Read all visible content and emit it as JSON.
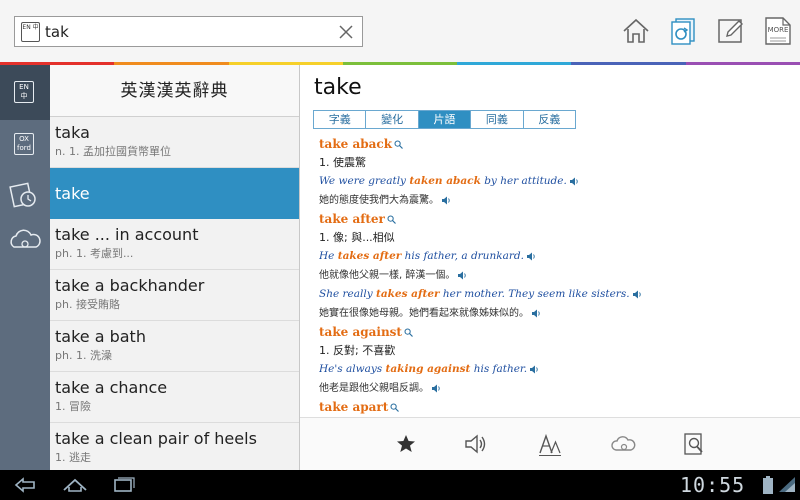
{
  "search": {
    "lang_badge": "EN 中",
    "value": "tak",
    "placeholder": ""
  },
  "toolbar": {
    "more_label": "MORE",
    "icons": [
      "home-icon",
      "flashcard-sync-icon",
      "note-edit-icon",
      "more-icon"
    ]
  },
  "rail": {
    "items": [
      {
        "icon": "en-zh-dictionary-icon",
        "badge": "EN 中"
      },
      {
        "icon": "oxford-dictionary-icon",
        "badge": "OX ford"
      },
      {
        "icon": "history-icon"
      },
      {
        "icon": "cloud-settings-icon"
      }
    ]
  },
  "wordlist": {
    "header": "英漢漢英辭典",
    "items": [
      {
        "word": "taka",
        "gloss": "n. 1. 孟加拉國貨幣單位"
      },
      {
        "word": "take",
        "gloss": "",
        "selected": true
      },
      {
        "word": "take ... in account",
        "gloss": "ph. 1. 考慮到..."
      },
      {
        "word": "take a backhander",
        "gloss": "ph. 接受賄賂"
      },
      {
        "word": "take a bath",
        "gloss": "ph. 1. 洗澡"
      },
      {
        "word": "take a chance",
        "gloss": "1. 冒險"
      },
      {
        "word": "take a clean pair of heels",
        "gloss": "1. 逃走"
      }
    ]
  },
  "definition": {
    "headword": "take",
    "tabs": [
      {
        "label": "字義",
        "active": false
      },
      {
        "label": "變化",
        "active": false
      },
      {
        "label": "片語",
        "active": true
      },
      {
        "label": "同義",
        "active": false
      },
      {
        "label": "反義",
        "active": false
      }
    ],
    "entries": [
      {
        "type": "phrase",
        "text": "take aback"
      },
      {
        "type": "meaning",
        "text": "1. 使震驚"
      },
      {
        "type": "ex_en",
        "before": "We were greatly ",
        "hl": "taken aback",
        "after": " by her attitude."
      },
      {
        "type": "ex_zh",
        "text": "她的態度使我們大為震驚。"
      },
      {
        "type": "phrase",
        "text": "take after"
      },
      {
        "type": "meaning",
        "text": "1. 像; 與...相似"
      },
      {
        "type": "ex_en",
        "before": "He ",
        "hl": "takes after",
        "after": " his father, a drunkard."
      },
      {
        "type": "ex_zh",
        "text": "他就像他父親一樣, 醉漢一個。"
      },
      {
        "type": "ex_en",
        "before": "She really ",
        "hl": "takes after",
        "after": " her mother. They seem like sisters."
      },
      {
        "type": "ex_zh",
        "text": "她實在很像她母親。她們看起來就像姊妹似的。"
      },
      {
        "type": "phrase",
        "text": "take against"
      },
      {
        "type": "meaning",
        "text": "1. 反對; 不喜歡"
      },
      {
        "type": "ex_en",
        "before": "He's always ",
        "hl": "taking against",
        "after": " his father."
      },
      {
        "type": "ex_zh",
        "text": "他老是跟他父親唱反調。"
      },
      {
        "type": "phrase",
        "text": "take apart"
      }
    ],
    "bottom_icons": [
      "star-icon",
      "speaker-icon",
      "font-size-icon",
      "cloud-icon",
      "search-page-icon"
    ]
  },
  "system": {
    "clock": "10:55"
  },
  "colors": {
    "accent": "#2f8fc2",
    "phrase": "#e36c13",
    "example": "#1f4fa0",
    "rail": "#5d6c7e",
    "rainbow": [
      "#e4312b",
      "#f08c1e",
      "#f6d02a",
      "#7cbf3b",
      "#2fa8d8",
      "#4a63b8",
      "#9a4fb3"
    ]
  }
}
